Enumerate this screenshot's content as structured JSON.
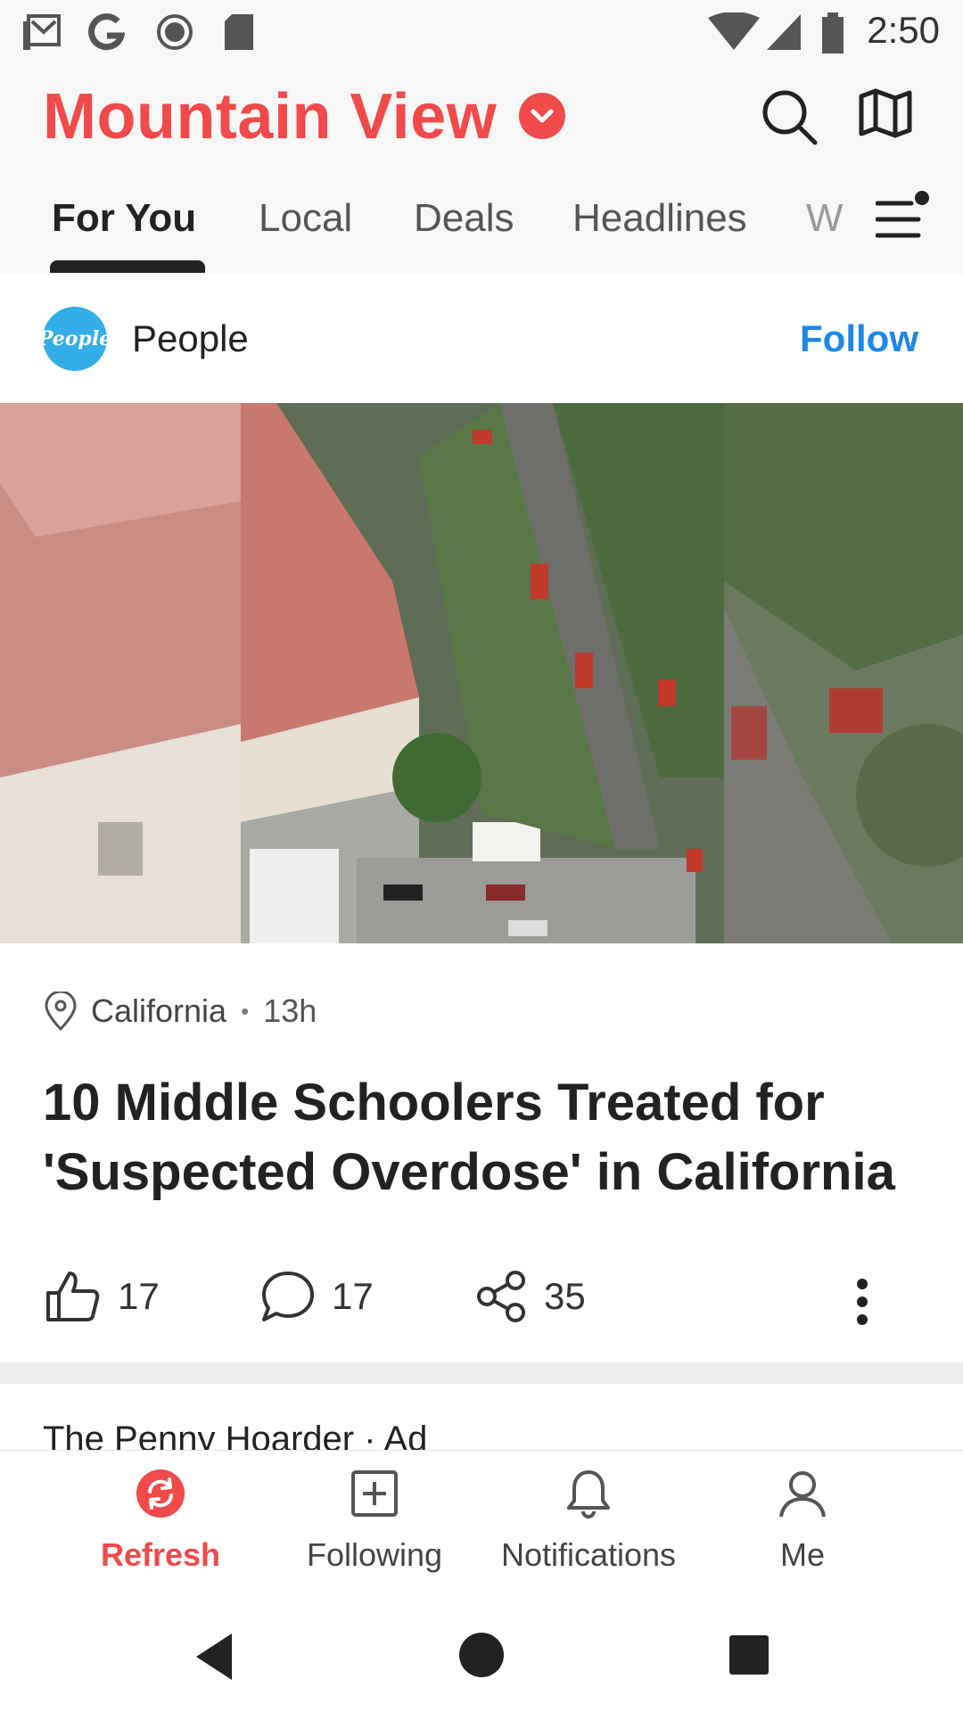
{
  "status_bar": {
    "time": "2:50",
    "icons": [
      "gmail-icon",
      "google-icon",
      "record-icon",
      "sd-card-icon",
      "wifi-icon",
      "signal-icon",
      "battery-icon"
    ]
  },
  "header": {
    "city": "Mountain View",
    "tabs": [
      {
        "label": "For You",
        "active": true
      },
      {
        "label": "Local"
      },
      {
        "label": "Deals"
      },
      {
        "label": "Headlines"
      },
      {
        "label": "W"
      }
    ]
  },
  "article": {
    "publisher": "People",
    "publisher_logo_text": "People",
    "follow_label": "Follow",
    "location": "California",
    "separator": "•",
    "time_ago": "13h",
    "headline": "10 Middle Schoolers Treated for 'Suspected Overdose' in California",
    "likes": "17",
    "comments": "17",
    "shares": "35"
  },
  "next_card": {
    "title": "The Penny Hoarder · Ad"
  },
  "bottom_nav": {
    "items": [
      {
        "label": "Refresh",
        "active": true
      },
      {
        "label": "Following"
      },
      {
        "label": "Notifications"
      },
      {
        "label": "Me"
      }
    ]
  },
  "colors": {
    "accent": "#f04a4a",
    "link": "#1e88e5",
    "text": "#222222"
  }
}
